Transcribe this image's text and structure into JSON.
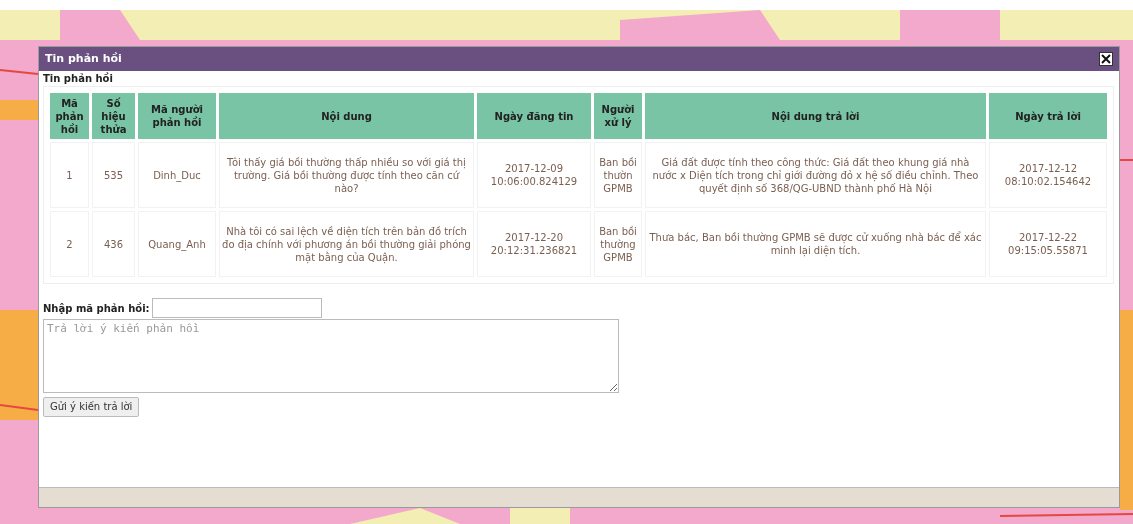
{
  "dialog": {
    "title": "Tin phản hồi",
    "section_label": "Tin phản hồi"
  },
  "table": {
    "columns": [
      "Mã phản hồi",
      "Số hiệu thửa",
      "Mã người phản hồi",
      "Nội dung",
      "Ngày đăng tin",
      "Người xử lý",
      "Nội dung trả lời",
      "Ngày trả lời"
    ],
    "rows": [
      [
        "1",
        "535",
        "Dinh_Duc",
        "Tôi thấy giá bồi thường thấp nhiều so với giá thị trường. Giá bồi thường được tính theo căn cứ nào?",
        "2017-12-09 10:06:00.824129",
        "Ban bồi thườn GPMB",
        "Giá đất được tính theo công thức: Giá đất theo khung giá nhà nước x Diện tích trong chỉ giới đường đỏ x hệ số điều chỉnh. Theo quyết định số 368/QG-UBND thành phố Hà Nội",
        "2017-12-12 08:10:02.154642"
      ],
      [
        "2",
        "436",
        "Quang_Anh",
        "Nhà tôi có sai lệch về diện tích trên bản đồ trích đo địa chính với phương án bồi thường giải phóng mặt bằng của Quận.",
        "2017-12-20 20:12:31.236821",
        "Ban bồi thường GPMB",
        "Thưa bác, Ban bồi thường GPMB sẽ được cử xuống nhà bác để xác minh lại diện tích.",
        "2017-12-22 09:15:05.55871"
      ]
    ]
  },
  "reply_form": {
    "code_label": "Nhập mã phản hồi:",
    "reply_placeholder": "Trả lời ý kiến phản hồi",
    "submit_button": "Gửi ý kiến trả lời"
  }
}
